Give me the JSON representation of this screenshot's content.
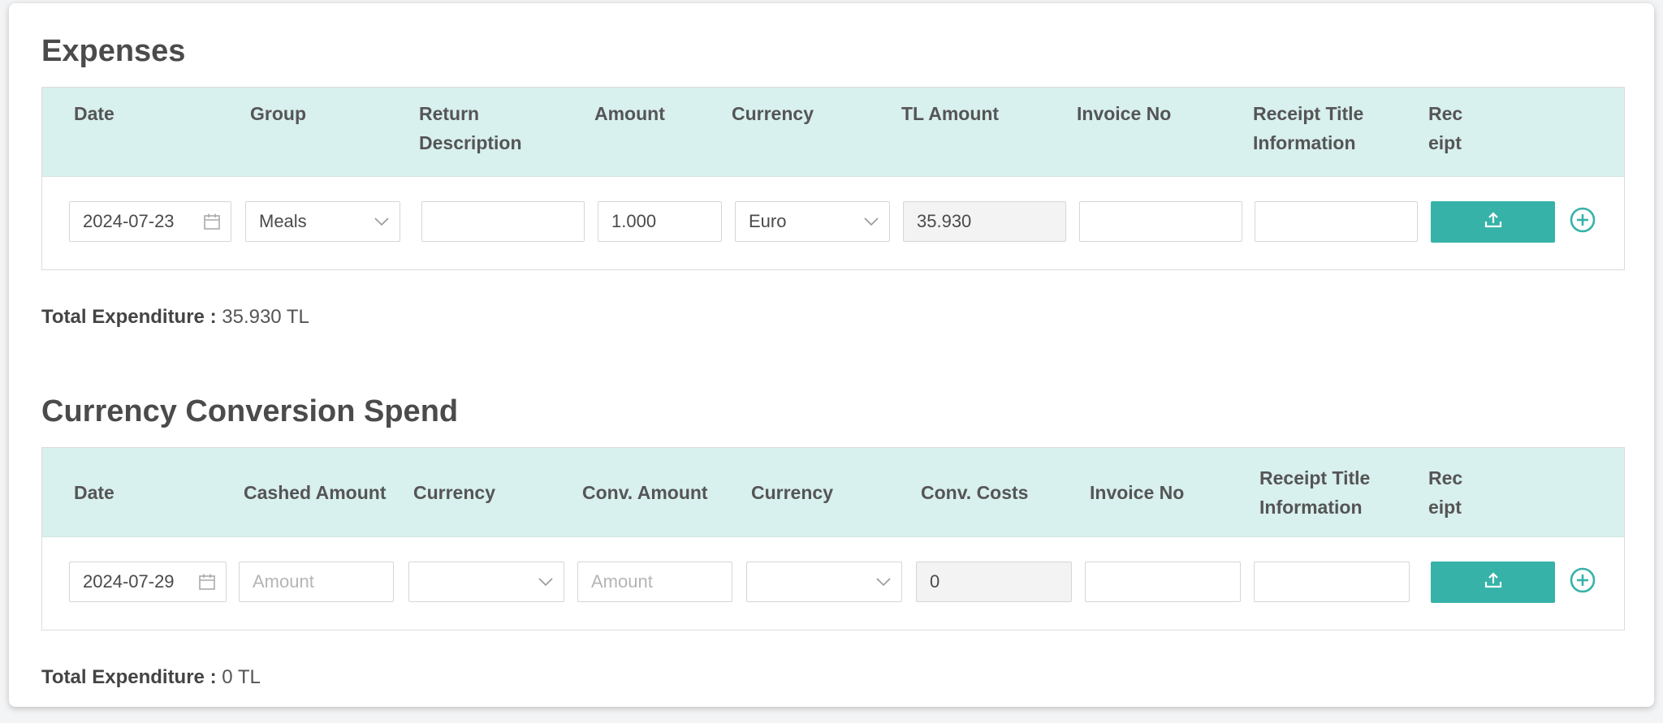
{
  "colors": {
    "accent": "#36b2a8",
    "header_bg": "#d8f0ee"
  },
  "expenses": {
    "title": "Expenses",
    "headers": {
      "date": "Date",
      "group": "Group",
      "return_description": "Return\nDescription",
      "amount": "Amount",
      "currency": "Currency",
      "tl_amount": "TL Amount",
      "invoice_no": "Invoice No",
      "receipt_title": "Receipt Title\nInformation",
      "receipt": "Rec\neipt"
    },
    "row": {
      "date": "2024-07-23",
      "group": "Meals",
      "return_description": "",
      "amount": "1.000",
      "currency": "Euro",
      "tl_amount": "35.930",
      "invoice_no": "",
      "receipt_title": ""
    },
    "total_label": "Total Expenditure :",
    "total_value": "35.930 TL"
  },
  "conversion": {
    "title": "Currency Conversion Spend",
    "headers": {
      "date": "Date",
      "cashed_amount": "Cashed Amount",
      "currency": "Currency",
      "conv_amount": "Conv. Amount",
      "currency2": "Currency",
      "conv_costs": "Conv. Costs",
      "invoice_no": "Invoice No",
      "receipt_title": "Receipt Title\nInformation",
      "receipt": "Rec\neipt"
    },
    "row": {
      "date": "2024-07-29",
      "cashed_amount_placeholder": "Amount",
      "currency": "",
      "conv_amount_placeholder": "Amount",
      "currency2": "",
      "conv_costs": "0",
      "invoice_no": "",
      "receipt_title": ""
    },
    "total_label": "Total Expenditure :",
    "total_value": "0 TL"
  }
}
